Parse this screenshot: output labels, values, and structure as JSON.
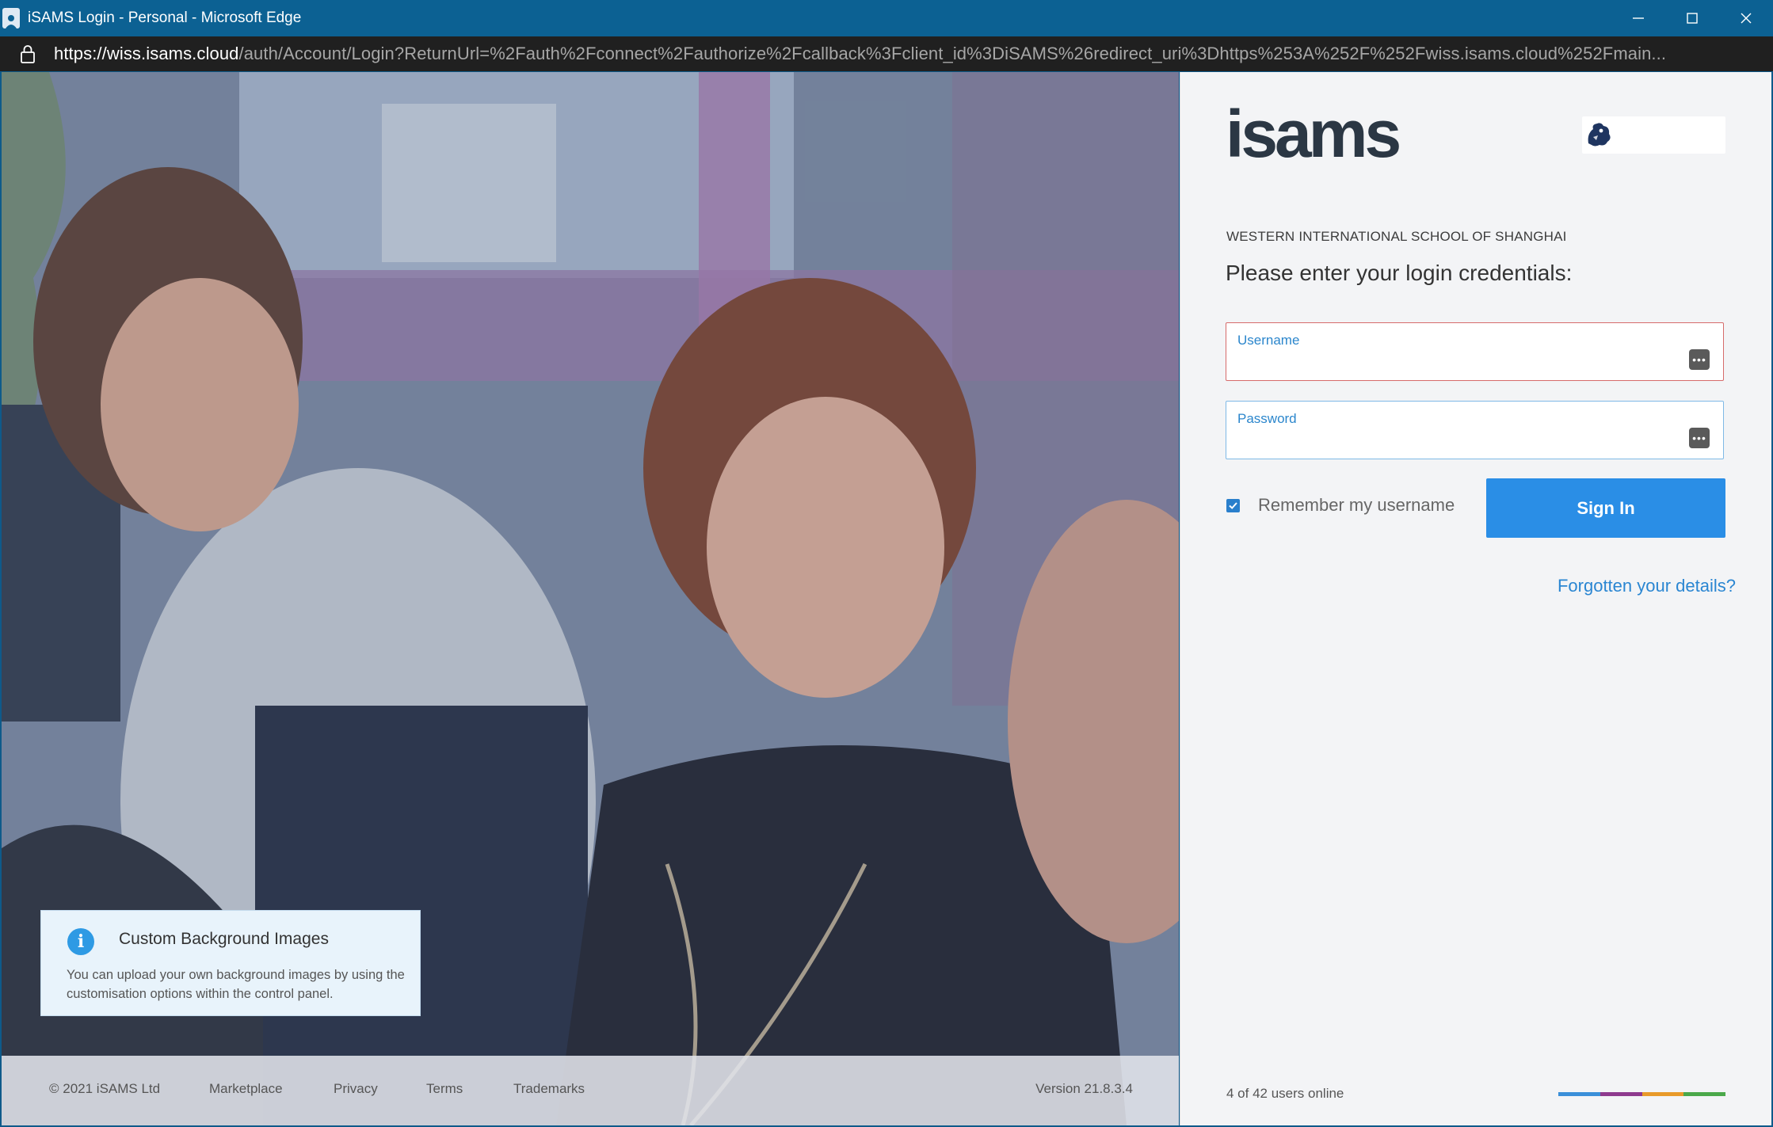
{
  "window": {
    "title": "iSAMS Login - Personal - Microsoft Edge",
    "icon": "browser-profile-icon",
    "controls": [
      "minimize-icon",
      "maximize-icon",
      "close-icon"
    ]
  },
  "addressbar": {
    "lock_icon": "lock-icon",
    "url_scheme": "https://",
    "url_host": "wiss.isams.cloud",
    "url_rest": "/auth/Account/Login?ReturnUrl=%2Fauth%2Fconnect%2Fauthorize%2Fcallback%3Fclient_id%3DiSAMS%26redirect_uri%3Dhttps%253A%252F%252Fwiss.isams.cloud%252Fmain..."
  },
  "info_box": {
    "icon": "info-icon",
    "icon_glyph": "i",
    "title": "Custom Background Images",
    "text": "You can upload your own background images by using the customisation options within the control panel."
  },
  "footer": {
    "copyright": "© 2021 iSAMS Ltd",
    "links": [
      "Marketplace",
      "Privacy",
      "Terms",
      "Trademarks"
    ],
    "version": "Version  21.8.3.4"
  },
  "login": {
    "logo": "isams",
    "school_badge_icon": "school-crest-icon",
    "school_name": "WESTERN INTERNATIONAL SCHOOL OF SHANGHAI",
    "prompt": "Please enter your login credentials:",
    "username": {
      "label": "Username",
      "value": ""
    },
    "password": {
      "label": "Password",
      "value": ""
    },
    "remember_label": "Remember my username",
    "remember_checked": true,
    "signin_label": "Sign In",
    "forgot_label": "Forgotten your details?",
    "users_online": "4 of 42 users online",
    "accent_colors": [
      "#3a8fd9",
      "#8e3a8e",
      "#e89a2a",
      "#4aa84a"
    ]
  }
}
